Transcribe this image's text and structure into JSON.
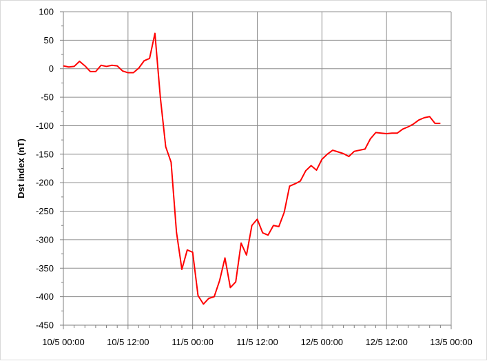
{
  "chart_data": {
    "type": "line",
    "title": "",
    "xlabel": "",
    "ylabel": "Dst index (nT)",
    "ylim": [
      -450,
      100
    ],
    "y_major_step": 50,
    "x_tick_labels": [
      "10/5 00:00",
      "10/5 12:00",
      "11/5 00:00",
      "11/5 12:00",
      "12/5 00:00",
      "12/5 12:00",
      "13/5 00:00"
    ],
    "x_range_hours": [
      0,
      72
    ],
    "grid": true,
    "legend": "none",
    "line_color": "#ff0000",
    "series": [
      {
        "name": "",
        "x_hours": [
          0,
          1,
          2,
          3,
          4,
          5,
          6,
          7,
          8,
          9,
          10,
          11,
          12,
          13,
          14,
          15,
          16,
          17,
          18,
          19,
          20,
          21,
          22,
          23,
          24,
          25,
          26,
          27,
          28,
          29,
          30,
          31,
          32,
          33,
          34,
          35,
          36,
          37,
          38,
          39,
          40,
          41,
          42,
          43,
          44,
          45,
          46,
          47,
          48,
          49,
          50,
          51,
          52,
          53,
          54,
          55,
          56,
          57,
          58,
          59,
          60,
          61,
          62,
          63,
          64,
          65,
          66,
          67,
          68,
          69,
          70
        ],
        "values": [
          5,
          3,
          4,
          13,
          5,
          -5,
          -5,
          6,
          4,
          6,
          5,
          -4,
          -7,
          -7,
          1,
          14,
          18,
          62,
          -50,
          -137,
          -164,
          -287,
          -352,
          -318,
          -322,
          -398,
          -413,
          -403,
          -400,
          -372,
          -332,
          -384,
          -374,
          -306,
          -327,
          -275,
          -264,
          -288,
          -292,
          -275,
          -277,
          -252,
          -206,
          -202,
          -197,
          -179,
          -170,
          -178,
          -159,
          -150,
          -143,
          -146,
          -149,
          -154,
          -145,
          -143,
          -141,
          -123,
          -112,
          -113,
          -114,
          -113,
          -113,
          -106,
          -102,
          -97,
          -90,
          -86,
          -84,
          -96,
          -96
        ]
      }
    ]
  }
}
